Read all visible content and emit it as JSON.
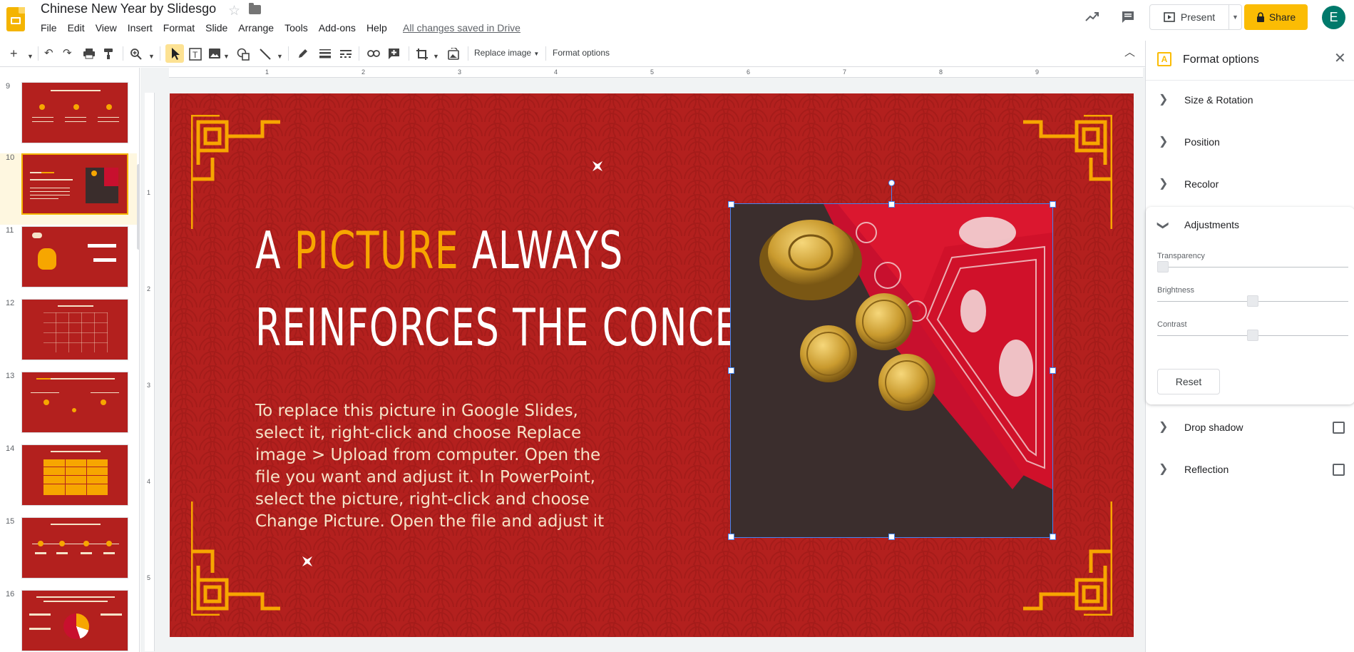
{
  "header": {
    "doc_title": "Chinese New Year by Slidesgo",
    "saved_status": "All changes saved in Drive",
    "menu": [
      "File",
      "Edit",
      "View",
      "Insert",
      "Format",
      "Slide",
      "Arrange",
      "Tools",
      "Add-ons",
      "Help"
    ],
    "present_label": "Present",
    "share_label": "Share",
    "avatar_letter": "E"
  },
  "toolbar": {
    "replace_image_label": "Replace image",
    "format_options_label": "Format options"
  },
  "ruler": {
    "top_numbers": [
      "1",
      "2",
      "3",
      "4",
      "5",
      "6",
      "7",
      "8",
      "9"
    ],
    "left_numbers": [
      "1",
      "2",
      "3",
      "4",
      "5"
    ]
  },
  "filmstrip": {
    "slides": [
      {
        "num": "9"
      },
      {
        "num": "10",
        "selected": true
      },
      {
        "num": "11"
      },
      {
        "num": "12"
      },
      {
        "num": "13"
      },
      {
        "num": "14"
      },
      {
        "num": "15"
      },
      {
        "num": "16"
      }
    ]
  },
  "slide": {
    "title_line1_pre": "A ",
    "title_line1_highlight": "PICTURE",
    "title_line1_post": " ALWAYS",
    "title_line2": "REINFORCES THE CONCEPT",
    "body": "To replace this picture in Google Slides, select it, right-click and choose Replace image > Upload from computer. Open the file you want and adjust it. In PowerPoint, select the picture, right-click and choose Change Picture. Open the file and adjust it",
    "colors": {
      "background": "#b3201e",
      "accent": "#f7a600",
      "text": "#f5e3c8"
    }
  },
  "panel": {
    "title": "Format options",
    "sections": {
      "size_rotation": "Size & Rotation",
      "position": "Position",
      "recolor": "Recolor",
      "adjustments": "Adjustments",
      "drop_shadow": "Drop shadow",
      "reflection": "Reflection"
    },
    "adjustments": {
      "transparency_label": "Transparency",
      "transparency_value": 0,
      "brightness_label": "Brightness",
      "brightness_value": 0.5,
      "contrast_label": "Contrast",
      "contrast_value": 0.5,
      "reset_label": "Reset"
    }
  }
}
